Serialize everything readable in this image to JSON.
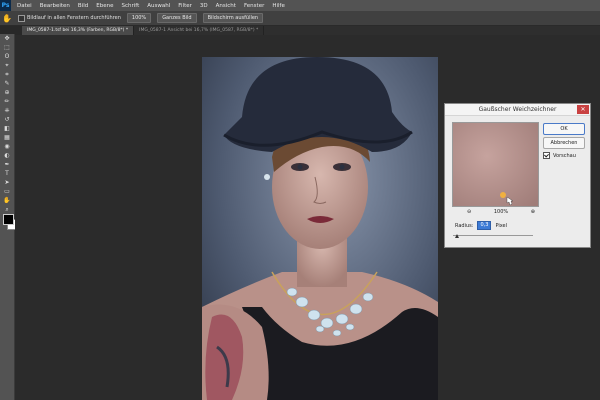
{
  "menubar": {
    "logo": "Ps",
    "items": [
      "Datei",
      "Bearbeiten",
      "Bild",
      "Ebene",
      "Schrift",
      "Auswahl",
      "Filter",
      "3D",
      "Ansicht",
      "Fenster",
      "Hilfe"
    ]
  },
  "optionsbar": {
    "tool_icon": "hand-icon",
    "scroll_all_label": "Bildlauf in allen Fenstern durchführen",
    "zoom_100_label": "100%",
    "fit_screen_label": "Ganzes Bild",
    "fill_screen_label": "Bildschirm ausfüllen"
  },
  "tabs": [
    {
      "label": "IMG_0587-1.tsf bei 16,3% (Farben, RGB/8*) *",
      "active": true
    },
    {
      "label": "IMG_0587-1 Ansicht bei 16,7% (IMG_0587, RGB/8*) *",
      "active": false
    }
  ],
  "toolbar": {
    "tools": [
      "move-tool",
      "marquee-tool",
      "lasso-tool",
      "quick-select-tool",
      "crop-tool",
      "eyedropper-tool",
      "healing-tool",
      "brush-tool",
      "clone-tool",
      "history-brush-tool",
      "eraser-tool",
      "gradient-tool",
      "blur-tool",
      "dodge-tool",
      "pen-tool",
      "type-tool",
      "path-select-tool",
      "shape-tool",
      "hand-tool",
      "zoom-tool"
    ],
    "glyphs": [
      "✥",
      "⬚",
      "ʘ",
      "⌖",
      "⌗",
      "✎",
      "⊕",
      "✏",
      "⎈",
      "↺",
      "◧",
      "▦",
      "◉",
      "◐",
      "✒",
      "T",
      "➤",
      "▭",
      "✋",
      "⌕"
    ],
    "fg_color": "#000000",
    "bg_color": "#ffffff"
  },
  "document": {
    "background": "#2b2b2b"
  },
  "dialog": {
    "title": "Gaußscher Weichzeichner",
    "close_icon": "close-icon",
    "ok_label": "OK",
    "cancel_label": "Abbrechen",
    "preview_label": "Vorschau",
    "preview_checked": true,
    "zoom_out_icon": "zoom-out-icon",
    "zoom_level": "100%",
    "zoom_in_icon": "zoom-in-icon",
    "radius_label": "Radius:",
    "radius_value": "0,3",
    "radius_unit": "Pixel",
    "radius_slider_fraction": 0.05
  }
}
